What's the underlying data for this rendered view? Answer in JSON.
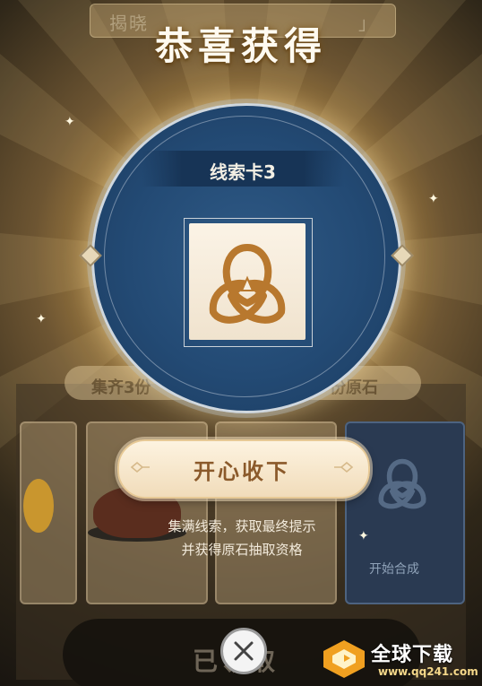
{
  "background": {
    "top_banner": "揭晓",
    "top_banner_right": "」",
    "collect_banner_left": "集齐3份",
    "collect_banner_right": "份原石",
    "start_merge_label": "开始合成",
    "claimed_label": "已领取"
  },
  "modal": {
    "title": "恭喜获得",
    "item_name": "线索卡3",
    "item_icon": "trinity-knot-icon",
    "confirm_button": "开心收下",
    "description_line1": "集满线索，获取最终提示",
    "description_line2": "并获得原石抽取资格"
  },
  "close_button": "close-icon",
  "watermark": {
    "name": "全球下载",
    "url": "www.qq241.com"
  },
  "colors": {
    "accent_gold": "#f1dcba",
    "button_text": "#8b5a2b",
    "circle_blue": "#234a74",
    "icon_brown": "#b8782e"
  }
}
